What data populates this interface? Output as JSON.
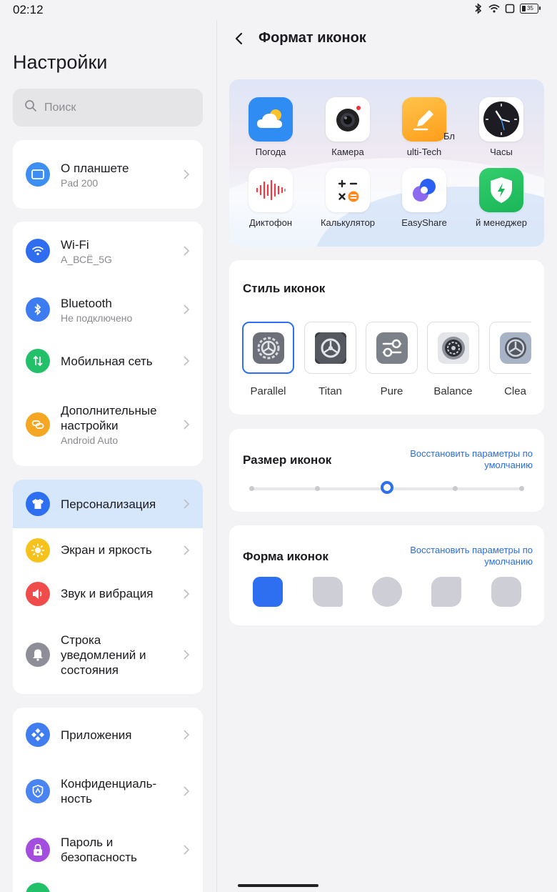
{
  "status": {
    "time": "02:12",
    "battery": "35"
  },
  "left": {
    "title": "Настройки",
    "search_placeholder": "Поиск",
    "groups": [
      {
        "items": [
          {
            "label": "О планшете",
            "sub": "Pad 200",
            "icon": "tablet-icon",
            "color": "#3d8ef2"
          }
        ]
      },
      {
        "items": [
          {
            "label": "Wi-Fi",
            "sub": "A_ВСЁ_5G",
            "icon": "wifi-icon",
            "color": "#2f6df0"
          },
          {
            "label": "Bluetooth",
            "sub": "Не подключено",
            "icon": "bluetooth-icon",
            "color": "#3d7bf0"
          },
          {
            "label": "Мобильная сеть",
            "sub": "",
            "icon": "mobile-network-icon",
            "color": "#23c06a"
          },
          {
            "label": "Дополнительные настройки",
            "sub": "Android Auto",
            "icon": "link-icon",
            "color": "#f5a623"
          }
        ]
      },
      {
        "items": [
          {
            "label": "Персонализация",
            "sub": "",
            "icon": "shirt-icon",
            "color": "#2d6ff0"
          },
          {
            "label": "Экран и яркость",
            "sub": "",
            "icon": "sun-icon",
            "color": "#f7c21c"
          },
          {
            "label": "Звук и вибрация",
            "sub": "",
            "icon": "speaker-icon",
            "color": "#f04c4c"
          },
          {
            "label": "Строка уведомлений и состояния",
            "sub": "",
            "icon": "bell-icon",
            "color": "#8e8e98"
          }
        ]
      },
      {
        "items": [
          {
            "label": "Приложения",
            "sub": "",
            "icon": "apps-icon",
            "color": "#3f7df0"
          },
          {
            "label": "Конфиденциаль-ность",
            "sub": "",
            "icon": "shield-icon",
            "color": "#4a83f2"
          },
          {
            "label": "Пароль и безопасность",
            "sub": "",
            "icon": "lock-icon",
            "color": "#a44ee0"
          }
        ]
      }
    ]
  },
  "right": {
    "title": "Формат иконок",
    "apps": [
      {
        "name": "Погода"
      },
      {
        "name": "Камера"
      },
      {
        "name": "ulti-Tech"
      },
      {
        "name": "Бл"
      },
      {
        "name": "Часы"
      },
      {
        "name": "Диктофон"
      },
      {
        "name": "Калькулятор"
      },
      {
        "name": "EasyShare"
      },
      {
        "name": "й менеджер"
      }
    ],
    "icon_style": {
      "title": "Стиль иконок",
      "options": [
        {
          "name": "Parallel",
          "selected": true
        },
        {
          "name": "Titan",
          "selected": false
        },
        {
          "name": "Pure",
          "selected": false
        },
        {
          "name": "Balance",
          "selected": false
        },
        {
          "name": "Clea",
          "selected": false
        }
      ]
    },
    "icon_size": {
      "title": "Размер иконок",
      "restore": "Восстановить параметры по умолчанию",
      "steps": 5,
      "selected_step": 3
    },
    "icon_shape": {
      "title": "Форма иконок",
      "restore": "Восстановить параметры по умолчанию",
      "selected": 1
    },
    "accent": "#2d6ff0"
  }
}
